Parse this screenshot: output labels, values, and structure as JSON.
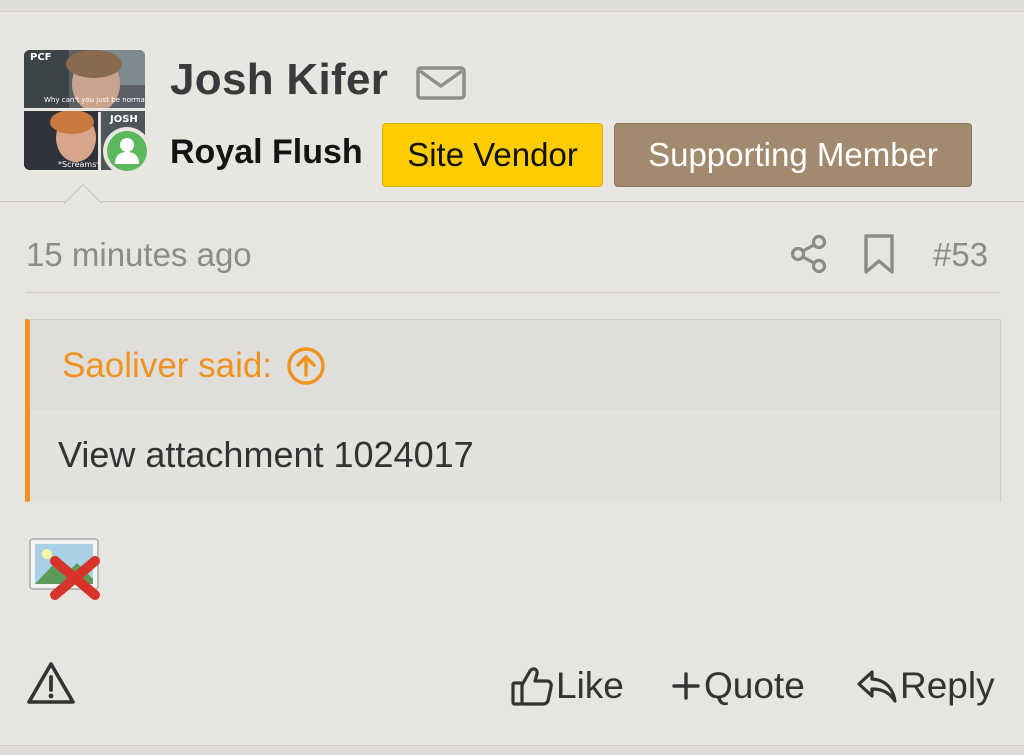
{
  "user": {
    "name": "Josh Kifer",
    "title": "Royal Flush",
    "avatar_captions": {
      "corner": "PCF",
      "line1": "Why can't you just be normal?",
      "name_tag": "JOSH",
      "bottom": "*Screams*"
    },
    "badges": [
      {
        "label": "Site Vendor",
        "bg": "#ffcc00",
        "fg": "#111111"
      },
      {
        "label": "Supporting Member",
        "bg": "#a28a6e",
        "fg": "#ffffff"
      }
    ],
    "presence_color": "#5cb85c"
  },
  "post": {
    "time": "15 minutes ago",
    "number": "#53",
    "quote": {
      "author_line": "Saoliver said:",
      "text": "View attachment 1024017",
      "accent": "#f0921e"
    }
  },
  "actions": {
    "like": "Like",
    "quote": "Quote",
    "reply": "Reply"
  },
  "icons": [
    "mail-icon",
    "share-icon",
    "bookmark-icon",
    "arrow-up-circle-icon",
    "broken-image-icon",
    "warning-icon",
    "thumbs-up-icon",
    "plus-icon",
    "reply-icon",
    "user-presence-icon"
  ]
}
